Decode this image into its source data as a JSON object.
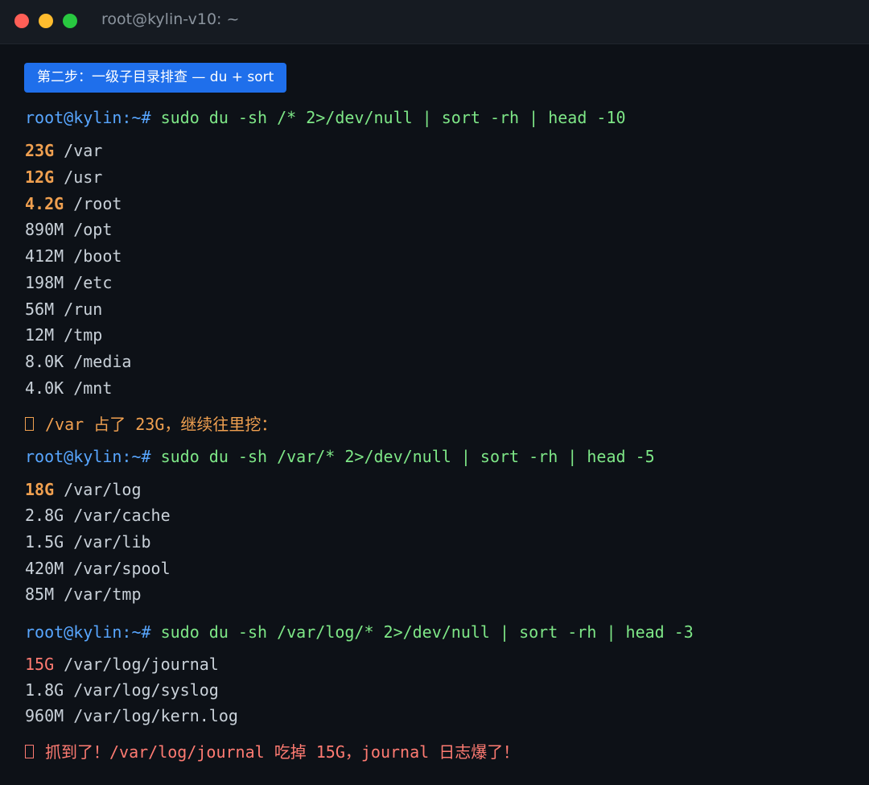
{
  "window": {
    "title": "root@kylin-v10: ~"
  },
  "badge": {
    "label": "第二步：一级子目录排查 — du + sort"
  },
  "colors": {
    "prompt": "#58a6ff",
    "command": "#7ee787",
    "highlight_orange": "#f0a050",
    "highlight_red": "#ff7b72",
    "badge_bg": "#1f6feb"
  },
  "block1": {
    "prompt": "root@kylin:~# ",
    "command": "sudo du -sh /* 2>/dev/null | sort -rh | head -10",
    "rows": [
      {
        "size": "23G",
        "path": " /var"
      },
      {
        "size": "12G",
        "path": " /usr"
      },
      {
        "size": "4.2G",
        "path": " /root"
      },
      {
        "size": "890M",
        "path": " /opt"
      },
      {
        "size": "412M",
        "path": " /boot"
      },
      {
        "size": "198M",
        "path": " /etc"
      },
      {
        "size": "56M",
        "path": " /run"
      },
      {
        "size": "12M",
        "path": " /tmp"
      },
      {
        "size": "8.0K",
        "path": " /media"
      },
      {
        "size": "4.0K",
        "path": " /mnt"
      }
    ],
    "note": "/var 占了 23G，继续往里挖："
  },
  "block2": {
    "prompt": "root@kylin:~# ",
    "command": "sudo du -sh /var/* 2>/dev/null | sort -rh | head -5",
    "rows": [
      {
        "size": "18G",
        "path": " /var/log"
      },
      {
        "size": "2.8G",
        "path": " /var/cache"
      },
      {
        "size": "1.5G",
        "path": " /var/lib"
      },
      {
        "size": "420M",
        "path": " /var/spool"
      },
      {
        "size": "85M",
        "path": " /var/tmp"
      }
    ]
  },
  "block3": {
    "prompt": "root@kylin:~# ",
    "command": "sudo du -sh /var/log/* 2>/dev/null | sort -rh | head -3",
    "rows": [
      {
        "size": "15G",
        "path": " /var/log/journal"
      },
      {
        "size": "1.8G",
        "path": " /var/log/syslog"
      },
      {
        "size": "960M",
        "path": " /var/log/kern.log"
      }
    ],
    "note": "抓到了！/var/log/journal 吃掉 15G，journal 日志爆了！"
  }
}
